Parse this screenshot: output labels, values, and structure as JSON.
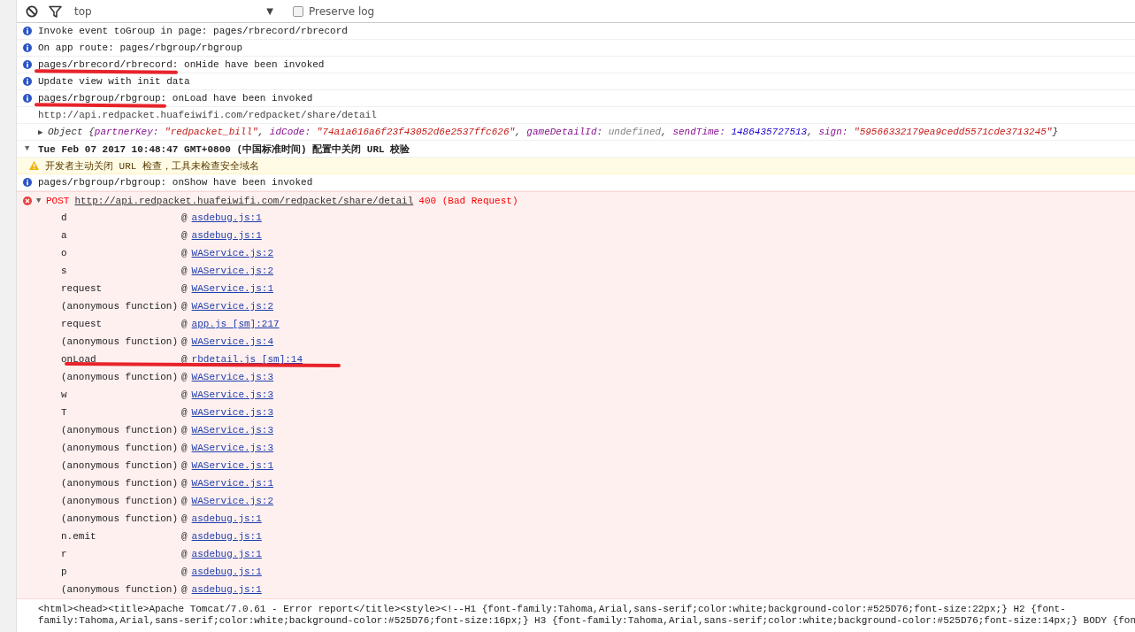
{
  "toolbar": {
    "context": "top",
    "context_caret": "▼",
    "preserve_log": {
      "label": "Preserve log",
      "checked": false
    }
  },
  "messages": [
    {
      "kind": "info",
      "segments": [
        {
          "text": "Invoke event toGroup in page: pages/rbrecord/rbrecord",
          "underlined": false
        }
      ]
    },
    {
      "kind": "info",
      "segments": [
        {
          "text": "On app route: pages/rbgroup/rbgroup",
          "underlined": false
        }
      ]
    },
    {
      "kind": "info",
      "segments": [
        {
          "text": "pages/rbrecord/rbrecord:",
          "underlined": true
        },
        {
          "text": " onHide have been invoked",
          "underlined": false
        }
      ]
    },
    {
      "kind": "info",
      "segments": [
        {
          "text": "Update view with init data",
          "underlined": false
        }
      ]
    },
    {
      "kind": "info",
      "segments": [
        {
          "text": "pages/rbgroup/rbgroup:",
          "underlined": true
        },
        {
          "text": " onLoad have been invoked",
          "underlined": false
        }
      ]
    },
    {
      "kind": "plain",
      "text": "http://api.redpacket.huafeiwifi.com/redpacket/share/detail"
    },
    {
      "kind": "object",
      "toggle": "▶",
      "expanded": false,
      "tokens": [
        {
          "text": "Object {",
          "kind": "punct"
        },
        {
          "text": "partnerKey:",
          "kind": "key"
        },
        {
          "text": " \"redpacket_bill\"",
          "kind": "string"
        },
        {
          "text": ", ",
          "kind": "punct"
        },
        {
          "text": "idCode:",
          "kind": "key"
        },
        {
          "text": " \"74a1a616a6f23f43052d6e2537ffc626\"",
          "kind": "string"
        },
        {
          "text": ", ",
          "kind": "punct"
        },
        {
          "text": "gameDetailId:",
          "kind": "key"
        },
        {
          "text": " undefined",
          "kind": "undefined"
        },
        {
          "text": ", ",
          "kind": "punct"
        },
        {
          "text": "sendTime:",
          "kind": "key"
        },
        {
          "text": " 1486435727513",
          "kind": "number"
        },
        {
          "text": ", ",
          "kind": "punct"
        },
        {
          "text": "sign:",
          "kind": "key"
        },
        {
          "text": " \"59566332179ea9cedd5571cde3713245\"",
          "kind": "string"
        },
        {
          "text": "}",
          "kind": "punct"
        }
      ]
    },
    {
      "kind": "group",
      "toggle": "▼",
      "expanded": true,
      "text": "Tue Feb 07 2017 10:48:47 GMT+0800 (中国标准时间) 配置中关闭 URL 校验"
    },
    {
      "kind": "warning",
      "text": "开发者主动关闭 URL 检查，工具未检查安全域名"
    },
    {
      "kind": "info",
      "segments": [
        {
          "text": "pages/rbgroup/rbgroup: onShow have been invoked",
          "underlined": false
        }
      ]
    },
    {
      "kind": "error",
      "toggle": "▼",
      "expanded": true,
      "method": "POST",
      "url": "http://api.redpacket.huafeiwifi.com/redpacket/share/detail",
      "status": "400 (Bad Request)",
      "stack": [
        {
          "fn": "d",
          "at": "@",
          "location": "asdebug.js:1",
          "underlined": false
        },
        {
          "fn": "a",
          "at": "@",
          "location": "asdebug.js:1",
          "underlined": false
        },
        {
          "fn": "o",
          "at": "@",
          "location": "WAService.js:2",
          "underlined": false
        },
        {
          "fn": "s",
          "at": "@",
          "location": "WAService.js:2",
          "underlined": false
        },
        {
          "fn": "request",
          "at": "@",
          "location": "WAService.js:1",
          "underlined": false
        },
        {
          "fn": "(anonymous function)",
          "at": "@",
          "location": "WAService.js:2",
          "underlined": false
        },
        {
          "fn": "request",
          "at": "@",
          "location": "app.js [sm]:217",
          "underlined": false
        },
        {
          "fn": "(anonymous function)",
          "at": "@",
          "location": "WAService.js:4",
          "underlined": false
        },
        {
          "fn": "onLoad",
          "at": "@",
          "location": "rbdetail.js [sm]:14",
          "underlined": true
        },
        {
          "fn": "(anonymous function)",
          "at": "@",
          "location": "WAService.js:3",
          "underlined": false
        },
        {
          "fn": "w",
          "at": "@",
          "location": "WAService.js:3",
          "underlined": false
        },
        {
          "fn": "T",
          "at": "@",
          "location": "WAService.js:3",
          "underlined": false
        },
        {
          "fn": "(anonymous function)",
          "at": "@",
          "location": "WAService.js:3",
          "underlined": false
        },
        {
          "fn": "(anonymous function)",
          "at": "@",
          "location": "WAService.js:3",
          "underlined": false
        },
        {
          "fn": "(anonymous function)",
          "at": "@",
          "location": "WAService.js:1",
          "underlined": false
        },
        {
          "fn": "(anonymous function)",
          "at": "@",
          "location": "WAService.js:1",
          "underlined": false
        },
        {
          "fn": "(anonymous function)",
          "at": "@",
          "location": "WAService.js:2",
          "underlined": false
        },
        {
          "fn": "(anonymous function)",
          "at": "@",
          "location": "asdebug.js:1",
          "underlined": false
        },
        {
          "fn": "n.emit",
          "at": "@",
          "location": "asdebug.js:1",
          "underlined": false
        },
        {
          "fn": "r",
          "at": "@",
          "location": "asdebug.js:1",
          "underlined": false
        },
        {
          "fn": "p",
          "at": "@",
          "location": "asdebug.js:1",
          "underlined": false
        },
        {
          "fn": "(anonymous function)",
          "at": "@",
          "location": "asdebug.js:1",
          "underlined": false
        }
      ]
    },
    {
      "kind": "html",
      "lines": [
        "<html><head><title>Apache Tomcat/7.0.61 - Error report</title><style><!--H1 {font-family:Tahoma,Arial,sans-serif;color:white;background-color:#525D76;font-size:22px;} H2 {font-",
        "family:Tahoma,Arial,sans-serif;color:white;background-color:#525D76;font-size:16px;} H3 {font-family:Tahoma,Arial,sans-serif;color:white;background-color:#525D76;font-size:14px;} BODY {fon"
      ]
    }
  ]
}
